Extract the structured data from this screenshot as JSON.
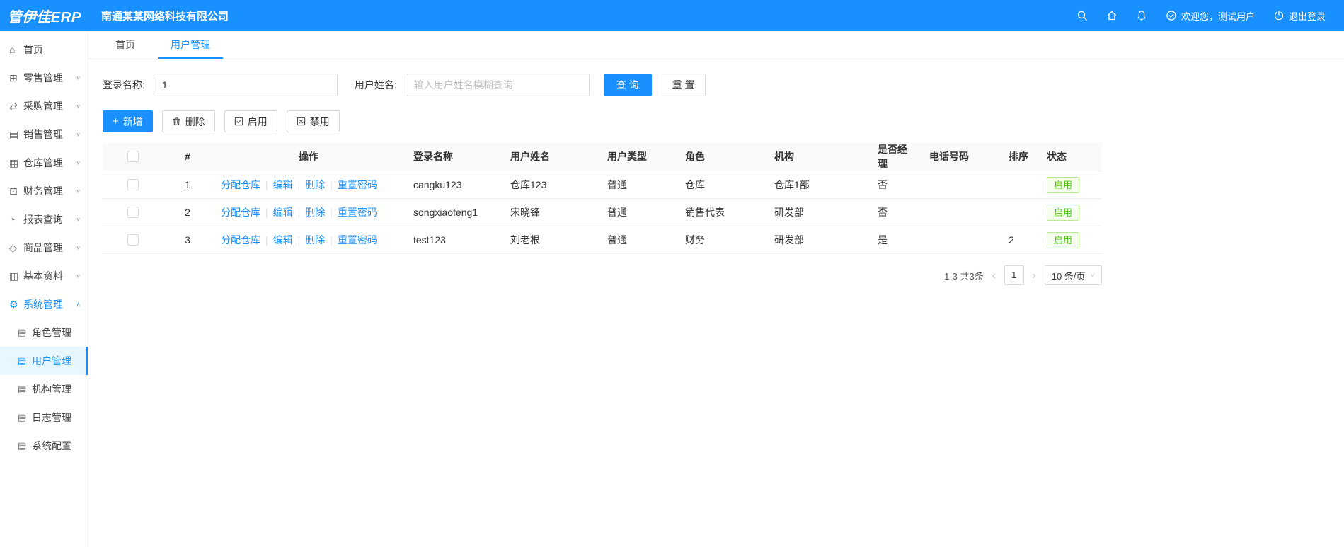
{
  "colors": {
    "primary": "#1890ff",
    "success": "#52c41a"
  },
  "topbar": {
    "logo": "管伊佳ERP",
    "company": "南通某某网络科技有限公司",
    "welcome": "欢迎您，测试用户",
    "logout": "退出登录"
  },
  "sidebar": {
    "items": [
      {
        "label": "首页",
        "glyph": "⌂"
      },
      {
        "label": "零售管理",
        "glyph": "⊞",
        "chevron": "∨"
      },
      {
        "label": "采购管理",
        "glyph": "⇄",
        "chevron": "∨"
      },
      {
        "label": "销售管理",
        "glyph": "▤",
        "chevron": "∨"
      },
      {
        "label": "仓库管理",
        "glyph": "▦",
        "chevron": "∨"
      },
      {
        "label": "财务管理",
        "glyph": "⊡",
        "chevron": "∨"
      },
      {
        "label": "报表查询",
        "glyph": "◔",
        "chevron": "∨"
      },
      {
        "label": "商品管理",
        "glyph": "◇",
        "chevron": "∨"
      },
      {
        "label": "基本资料",
        "glyph": "▥",
        "chevron": "∨"
      },
      {
        "label": "系统管理",
        "glyph": "⚙",
        "chevron": "∧"
      }
    ],
    "subitems": [
      {
        "label": "角色管理",
        "glyph": "▤"
      },
      {
        "label": "用户管理",
        "glyph": "▤"
      },
      {
        "label": "机构管理",
        "glyph": "▤"
      },
      {
        "label": "日志管理",
        "glyph": "▤"
      },
      {
        "label": "系统配置",
        "glyph": "▤"
      }
    ]
  },
  "tabs": [
    {
      "label": "首页"
    },
    {
      "label": "用户管理"
    }
  ],
  "filter": {
    "login_label": "登录名称:",
    "login_value": "1",
    "name_label": "用户姓名:",
    "name_placeholder": "输入用户姓名模糊查询",
    "search_btn": "查 询",
    "reset_btn": "重 置"
  },
  "toolbar": {
    "add_icon": "+",
    "add": "新增",
    "delete": "删除",
    "enable": "启用",
    "disable": "禁用"
  },
  "table": {
    "headers": [
      "#",
      "操作",
      "登录名称",
      "用户姓名",
      "用户类型",
      "角色",
      "机构",
      "是否经理",
      "电话号码",
      "排序",
      "状态"
    ],
    "op_links": [
      "分配仓库",
      "编辑",
      "删除",
      "重置密码"
    ],
    "rows": [
      {
        "num": "1",
        "login": "cangku123",
        "name": "仓库123",
        "type": "普通",
        "role": "仓库",
        "org": "仓库1部",
        "manager": "否",
        "phone": "",
        "sort": "",
        "status": "启用"
      },
      {
        "num": "2",
        "login": "songxiaofeng1",
        "name": "宋晓锋",
        "type": "普通",
        "role": "销售代表",
        "org": "研发部",
        "manager": "否",
        "phone": "",
        "sort": "",
        "status": "启用"
      },
      {
        "num": "3",
        "login": "test123",
        "name": "刘老根",
        "type": "普通",
        "role": "财务",
        "org": "研发部",
        "manager": "是",
        "phone": "",
        "sort": "2",
        "status": "启用"
      }
    ]
  },
  "pagination": {
    "total": "1-3 共3条",
    "prev": "‹",
    "page": "1",
    "next": "›",
    "page_size": "10 条/页",
    "caret": "∨"
  }
}
